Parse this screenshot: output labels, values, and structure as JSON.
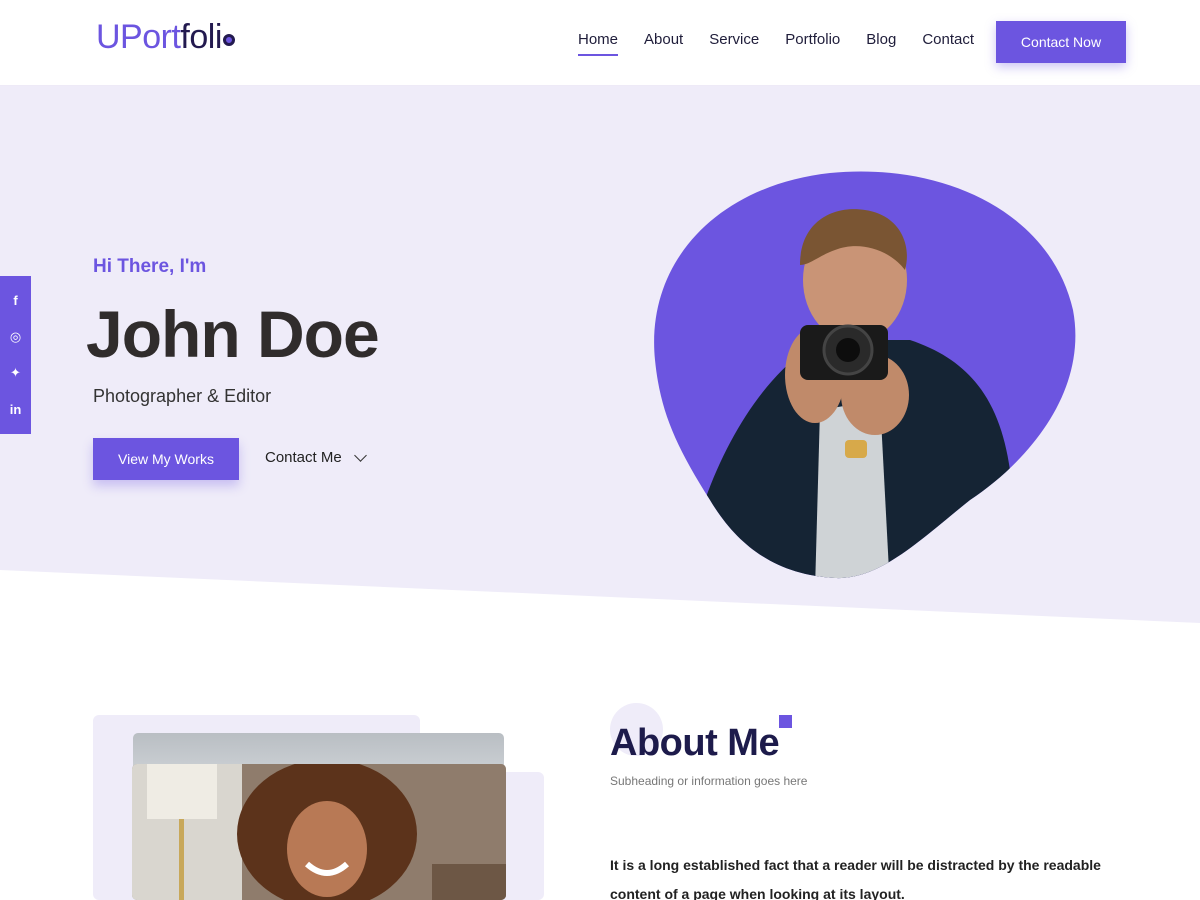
{
  "header": {
    "logo_part1": "UPort",
    "logo_part2": "foli",
    "nav": [
      "Home",
      "About",
      "Service",
      "Portfolio",
      "Blog",
      "Contact"
    ],
    "active_nav": "Home",
    "cta": "Contact Now"
  },
  "social": [
    {
      "icon": "facebook-icon",
      "glyph": "f"
    },
    {
      "icon": "instagram-icon",
      "glyph": "◎"
    },
    {
      "icon": "twitter-icon",
      "glyph": "✦"
    },
    {
      "icon": "linkedin-icon",
      "glyph": "in"
    }
  ],
  "hero": {
    "greeting": "Hi There, I'm",
    "name": "John Doe",
    "role": "Photographer & Editor",
    "primary_button": "View My Works",
    "secondary_button": "Contact Me"
  },
  "about": {
    "title": "About Me",
    "subtitle": "Subheading or information goes here",
    "text": "It is a long established fact that a reader will be distracted by the readable content of a page when looking at its layout."
  },
  "colors": {
    "accent": "#6c55e0",
    "hero_bg": "#efecf9",
    "heading_dark": "#1d1b4b"
  }
}
